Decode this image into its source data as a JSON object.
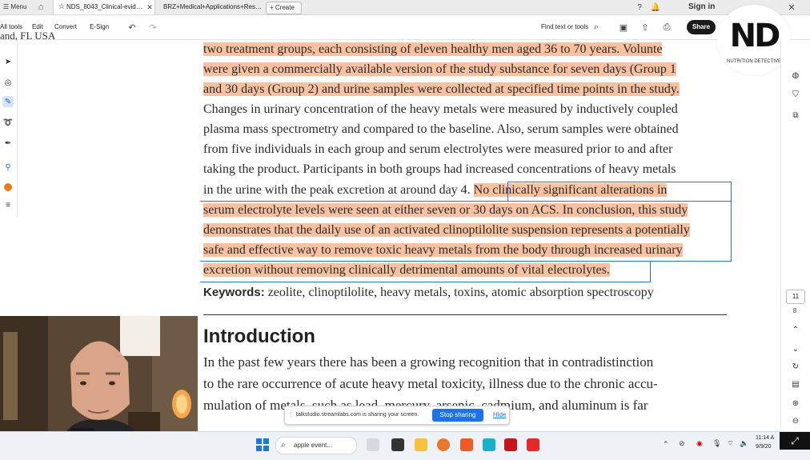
{
  "browser": {
    "menu_label": "Menu",
    "tabs": [
      {
        "label": "NDS_8043_Clinical-evid…",
        "active": true
      },
      {
        "label": "BRZ+Medical+Applications+Res…",
        "active": false
      }
    ],
    "create_label": "Create",
    "sign_in_label": "Sign in"
  },
  "toolbar": {
    "all_tools_label": "All tools",
    "menu_items": [
      "Edit",
      "Convert",
      "E-Sign"
    ],
    "find_label": "Find text or tools",
    "share_label": "Share"
  },
  "document": {
    "partial_top_text": "and, FL USA",
    "lines": [
      {
        "text": "two treatment groups, each consisting of eleven healthy men aged 36 to 70 years. Volunte",
        "hl": true
      },
      {
        "text": "were given a commercially available version of the study substance for seven days (Group 1",
        "hl": true
      },
      {
        "text": "and 30 days (Group 2) and urine samples were collected at specified time points in the study.",
        "hl": true
      },
      {
        "text": "Changes in urinary concentration of the heavy metals were measured by inductively coupled",
        "hl": false
      },
      {
        "text": "plasma mass spectrometry and compared to the baseline. Also, serum samples were obtained",
        "hl": false
      },
      {
        "text": "from five individuals in each group and serum electrolytes were measured prior to and after",
        "hl": false
      },
      {
        "text": "taking the product. Participants in both groups had increased concentrations of heavy metals",
        "hl": false
      }
    ],
    "line8_plain": "in the urine with the peak excretion at around day 4.",
    "line8_hl": "No clinically significant alterations in",
    "hl_lines": [
      "serum electrolyte levels were seen at either seven or 30 days on ACS. In conclusion, this study",
      "demonstrates that the daily use of an activated clinoptilolite suspension represents a potentially",
      "safe and effective way to remove toxic heavy metals from the body through increased urinary",
      "excretion without removing clinically detrimental amounts of vital electrolytes."
    ],
    "keywords_label": "Keywords:",
    "keywords_text": "zeolite, clinoptilolite, heavy metals, toxins, atomic absorption spectroscopy",
    "intro_heading": "Introduction",
    "intro_lines": [
      "In the past few years there has been a growing recognition that in contradistinction",
      "to the rare occurrence of acute heavy metal toxicity, illness due to the chronic accu-",
      "mulation of metals, such as lead, mercury, arsenic, cadmium, and aluminum is far"
    ]
  },
  "logo": {
    "text": "ND",
    "subtitle": "NUTRITION DETECTIVE"
  },
  "right_panel": {
    "page_current": "11",
    "page_total": "8"
  },
  "share_banner": {
    "message": "talkstudio.streamlabs.com is sharing your screen.",
    "stop_label": "Stop sharing",
    "hide_label": "Hide"
  },
  "taskbar": {
    "search_placeholder": "apple event...",
    "time": "11:14 A",
    "date": "9/9/20"
  },
  "colors": {
    "highlight": "#f8c2a2",
    "selection": "#2a73d9",
    "share_button": "#1a1a1a",
    "stop_sharing": "#1a73e8"
  },
  "icons": [
    "home-icon",
    "star-icon",
    "close-icon",
    "plus-icon",
    "help-icon",
    "bell-icon",
    "undo-icon",
    "redo-icon",
    "search-icon",
    "save-icon",
    "upload-icon",
    "print-icon",
    "cursor-icon",
    "comment-icon",
    "highlight-pen-icon",
    "lasso-icon",
    "stamp-icon",
    "pin-icon",
    "color-dot-icon",
    "menu-lines-icon",
    "refresh-icon",
    "zoom-in-icon",
    "zoom-out-icon",
    "expand-icon"
  ]
}
